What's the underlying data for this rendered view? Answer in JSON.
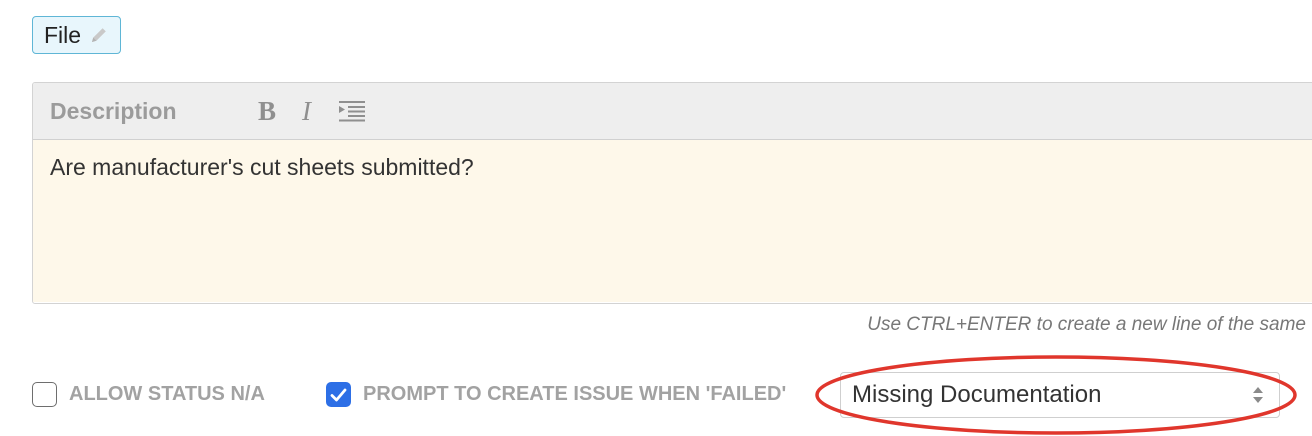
{
  "file_chip": {
    "label": "File"
  },
  "editor": {
    "title": "Description",
    "toolbar": {
      "bold_label": "B",
      "italic_label": "I"
    },
    "content": "Are manufacturer's cut sheets submitted?",
    "hint": "Use CTRL+ENTER to create a new line of the same"
  },
  "options": {
    "allow_status_na": {
      "label": "ALLOW STATUS N/A",
      "checked": false
    },
    "prompt_issue": {
      "label": "PROMPT TO CREATE ISSUE WHEN 'FAILED'",
      "checked": true
    }
  },
  "issue_type_select": {
    "value": "Missing Documentation"
  },
  "colors": {
    "accent": "#2d6fe6",
    "chip_border": "#5fb6d6",
    "editor_background": "#fef8ea",
    "annotation_ellipse": "#e0362c"
  },
  "icons": {
    "file_chip": "pencil-icon",
    "indent": "indent-icon",
    "select": "sort-arrows-icon",
    "checkbox": "checkmark-icon"
  }
}
